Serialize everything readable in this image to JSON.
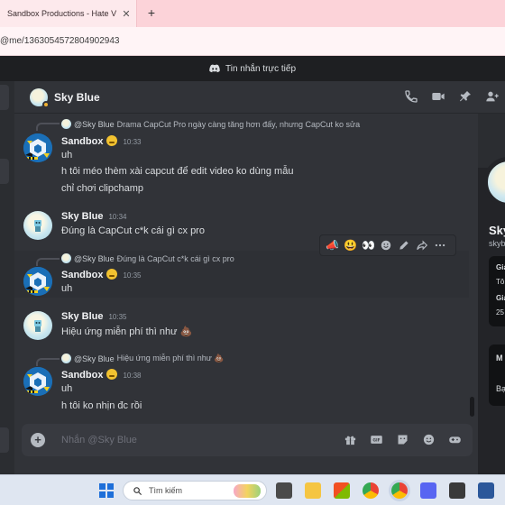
{
  "browser": {
    "tab_title": "Sandbox Productions - Hate V",
    "tab_close": "✕",
    "new_tab": "+",
    "url": "@me/1363054572804902943"
  },
  "discord": {
    "title": "Tin nhắn trực tiếp"
  },
  "header": {
    "name": "Sky Blue"
  },
  "messages": [
    {
      "reply_name": "@Sky Blue",
      "reply_text": "Drama CapCut Pro ngày càng tăng hơn đấy, nhưng CapCut ko sửa",
      "author": "Sandbox",
      "time": "10:33",
      "lines": [
        "uh",
        "h tôi méo thèm xài capcut để edit video ko dùng mẫu",
        "chỉ chơi clipchamp"
      ]
    },
    {
      "author": "Sky Blue",
      "time": "10:34",
      "lines": [
        "Đúng là CapCut c*k cái gì cx pro"
      ]
    },
    {
      "reply_name": "@Sky Blue",
      "reply_text": "Đúng là CapCut c*k cái gì cx pro",
      "author": "Sandbox",
      "time": "10:35",
      "lines": [
        "uh"
      ]
    },
    {
      "author": "Sky Blue",
      "time": "10:35",
      "lines": [
        "Hiệu ứng miễn phí thì như 💩"
      ]
    },
    {
      "reply_name": "@Sky Blue",
      "reply_text": "Hiệu ứng miễn phí thì như 💩",
      "author": "Sandbox",
      "time": "10:38",
      "lines": [
        "uh",
        "h tôi ko nhịn đc rồi"
      ]
    }
  ],
  "toolbar": {
    "reactions": [
      "📣",
      "😃",
      "👀"
    ]
  },
  "composer": {
    "placeholder": "Nhắn @Sky Blue"
  },
  "profile": {
    "name": "Sky",
    "username": "skyb",
    "card1": [
      "Gia",
      "Tô",
      "Gia",
      "25"
    ],
    "card2": [
      "M",
      "Bạ"
    ]
  },
  "taskbar": {
    "search_placeholder": "Tìm kiếm"
  },
  "colors": {
    "background": "#313338",
    "sidebar": "#2b2d31",
    "titlebar": "#1e1f22",
    "browser_tabs": "#fcd3d9",
    "accent_blue": "#1a6fb7",
    "badge_yellow": "#f2c230"
  }
}
